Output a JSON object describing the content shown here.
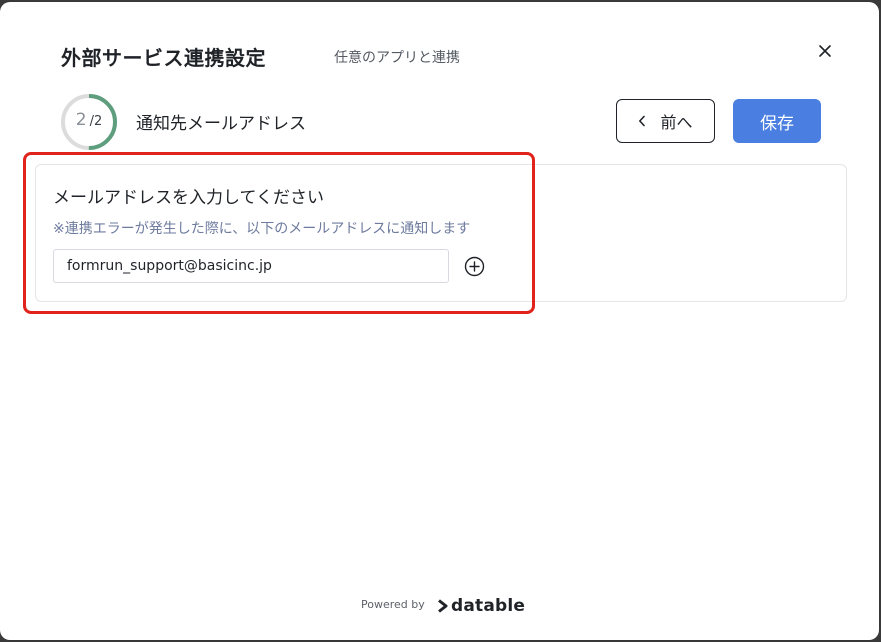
{
  "modal": {
    "title": "外部サービス連携設定",
    "subtitle": "任意のアプリと連携"
  },
  "step": {
    "current": "2",
    "total": "2",
    "progress": 1.0,
    "label": "通知先メールアドレス"
  },
  "actions": {
    "back_label": "前へ",
    "save_label": "保存"
  },
  "email_section": {
    "heading": "メールアドレスを入力してください",
    "note": "※連携エラーが発生した際に、以下のメールアドレスに通知します",
    "email_value": "formrun_support@basicinc.jp"
  },
  "footer": {
    "powered_by": "Powered by",
    "brand": "datable"
  },
  "colors": {
    "primary_button": "#4a7ee0",
    "progress_ring": "#5e9e7e",
    "highlight_border": "#e0231b"
  },
  "icons": [
    "close-icon",
    "chevron-left-icon",
    "plus-circle-icon",
    "datable-logo-icon"
  ]
}
